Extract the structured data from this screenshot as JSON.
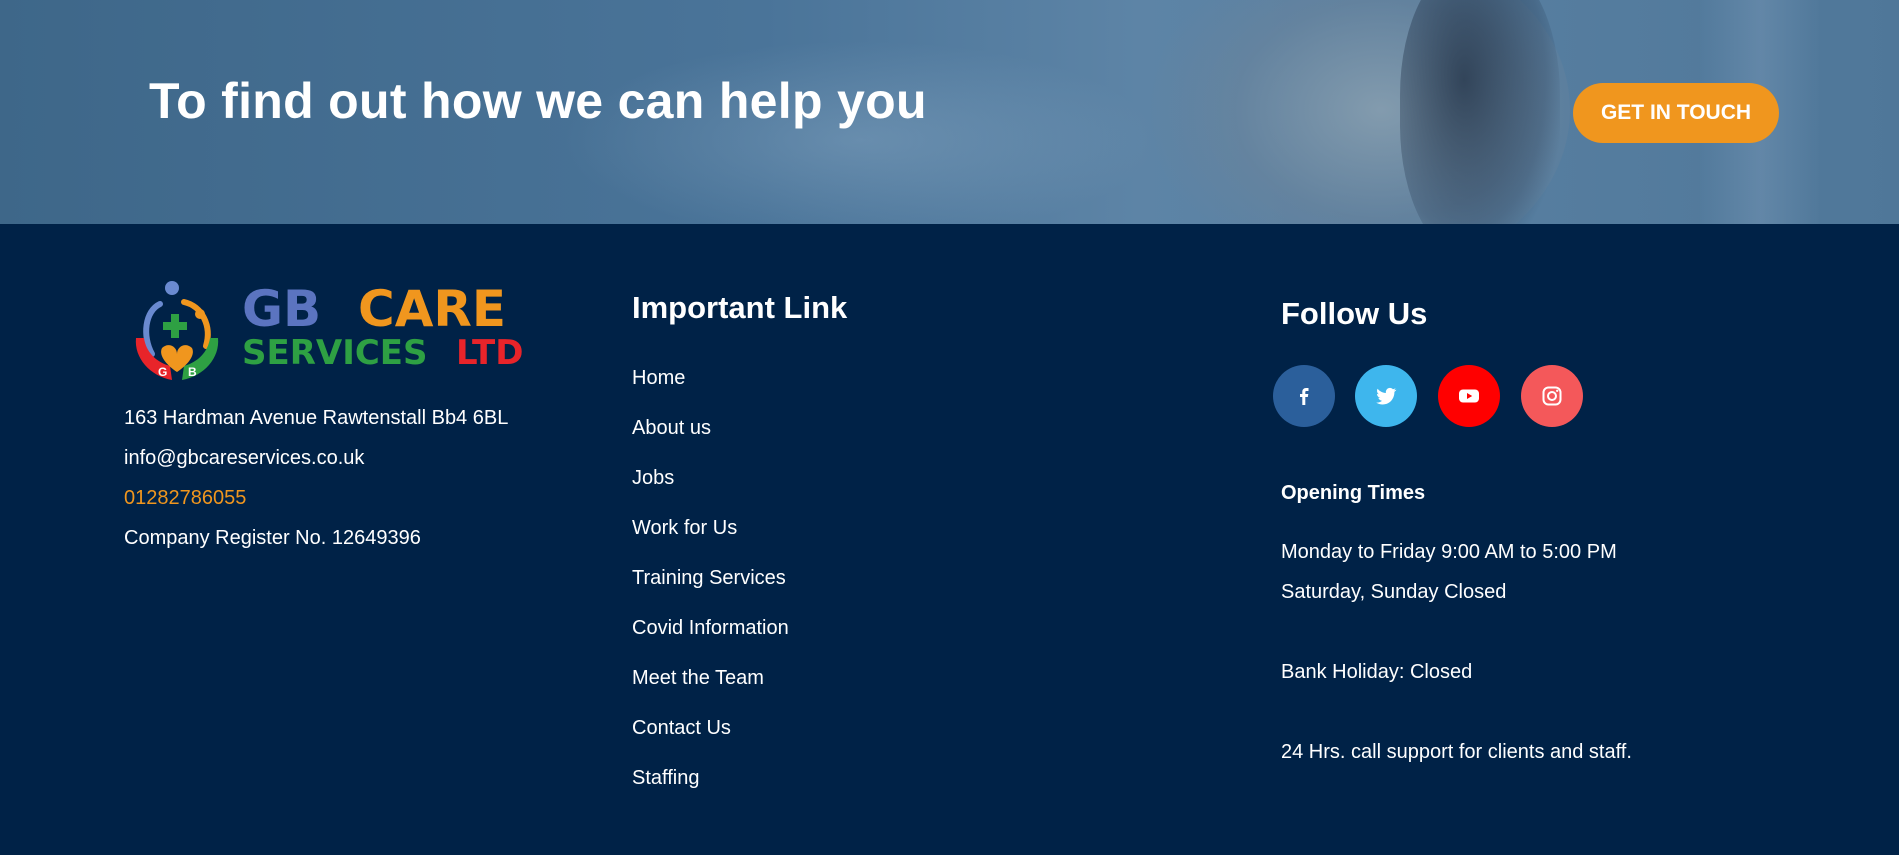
{
  "banner": {
    "title": "To find out how we can help you",
    "cta_label": "GET IN TOUCH"
  },
  "brand": {
    "logo_line1a": "GB",
    "logo_line1b": "CARE",
    "logo_line2a": "SERVICES",
    "logo_line2b": "LTD",
    "logo_letters": [
      "G",
      "B"
    ],
    "colors": {
      "blue": "#5b74c0",
      "orange": "#f0961e",
      "green": "#2ea043",
      "red": "#e8242a"
    }
  },
  "contact": {
    "address": "163 Hardman Avenue Rawtenstall Bb4 6BL",
    "email": "info@gbcareservices.co.uk",
    "phone": "01282786055",
    "company_reg": "Company Register No. 12649396"
  },
  "links": {
    "heading": "Important Link",
    "items": [
      "Home",
      "About us",
      "Jobs",
      "Work for Us",
      "Training Services",
      "Covid Information",
      "Meet the Team",
      "Contact Us",
      "Staffing"
    ]
  },
  "follow": {
    "heading": "Follow Us",
    "icons": [
      "facebook-icon",
      "twitter-icon",
      "youtube-icon",
      "instagram-icon"
    ]
  },
  "opening": {
    "title": "Opening Times",
    "weekdays": "Monday to Friday 9:00 AM to 5:00 PM",
    "weekend": "Saturday, Sunday Closed",
    "bank_holiday": "Bank Holiday: Closed",
    "support": "24 Hrs. call support for clients and staff."
  },
  "colors": {
    "footer_bg": "#002247",
    "accent": "#f0961e"
  }
}
